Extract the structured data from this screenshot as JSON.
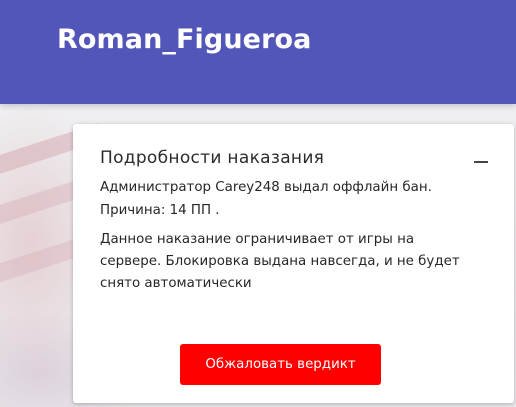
{
  "header": {
    "username": "Roman_Figueroa"
  },
  "punishment": {
    "title": "Подробности наказания",
    "collapse_icon": "minus-icon",
    "line1": "Администратор Carey248 выдал оффлайн бан.",
    "line2": "Причина: 14 ПП .",
    "desc1": "Данное наказание ограничивает от игры на",
    "desc2": "сервере. Блокировка выдана навсегда, и не будет",
    "desc3": "снято автоматически",
    "appeal_label": "Обжаловать вердикт"
  },
  "colors": {
    "header_bg": "#5356b9",
    "button_bg": "#ff0000"
  }
}
